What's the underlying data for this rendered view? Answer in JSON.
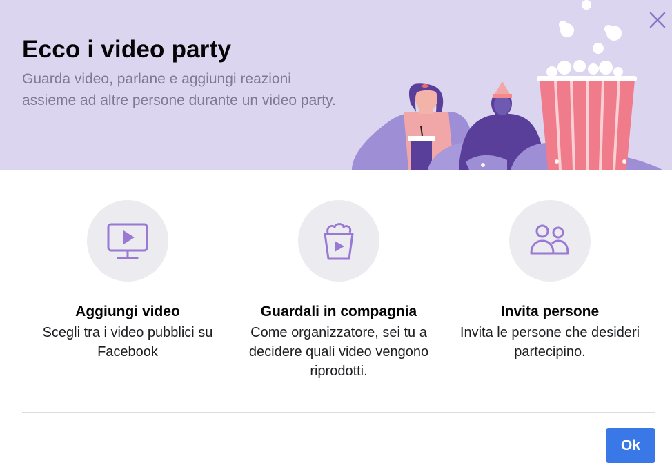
{
  "header": {
    "title": "Ecco i video party",
    "subtitle": "Guarda video, parlane e aggiungi reazioni assieme ad altre persone durante un video party.",
    "close_icon": "close-icon",
    "background_color": "#dcd5ef"
  },
  "features": [
    {
      "icon": "monitor-play-icon",
      "title": "Aggiungi video",
      "description": "Scegli tra i video pubblici su Facebook"
    },
    {
      "icon": "popcorn-play-icon",
      "title": "Guardali in compagnia",
      "description": "Come organizzatore, sei tu a decidere quali video vengono riprodotti."
    },
    {
      "icon": "people-icon",
      "title": "Invita persone",
      "description": "Invita le persone che desideri partecipino."
    }
  ],
  "footer": {
    "ok_label": "Ok",
    "button_color": "#3b78e7"
  },
  "colors": {
    "icon_purple": "#9a79d4",
    "icon_circle": "#ebebf0"
  }
}
